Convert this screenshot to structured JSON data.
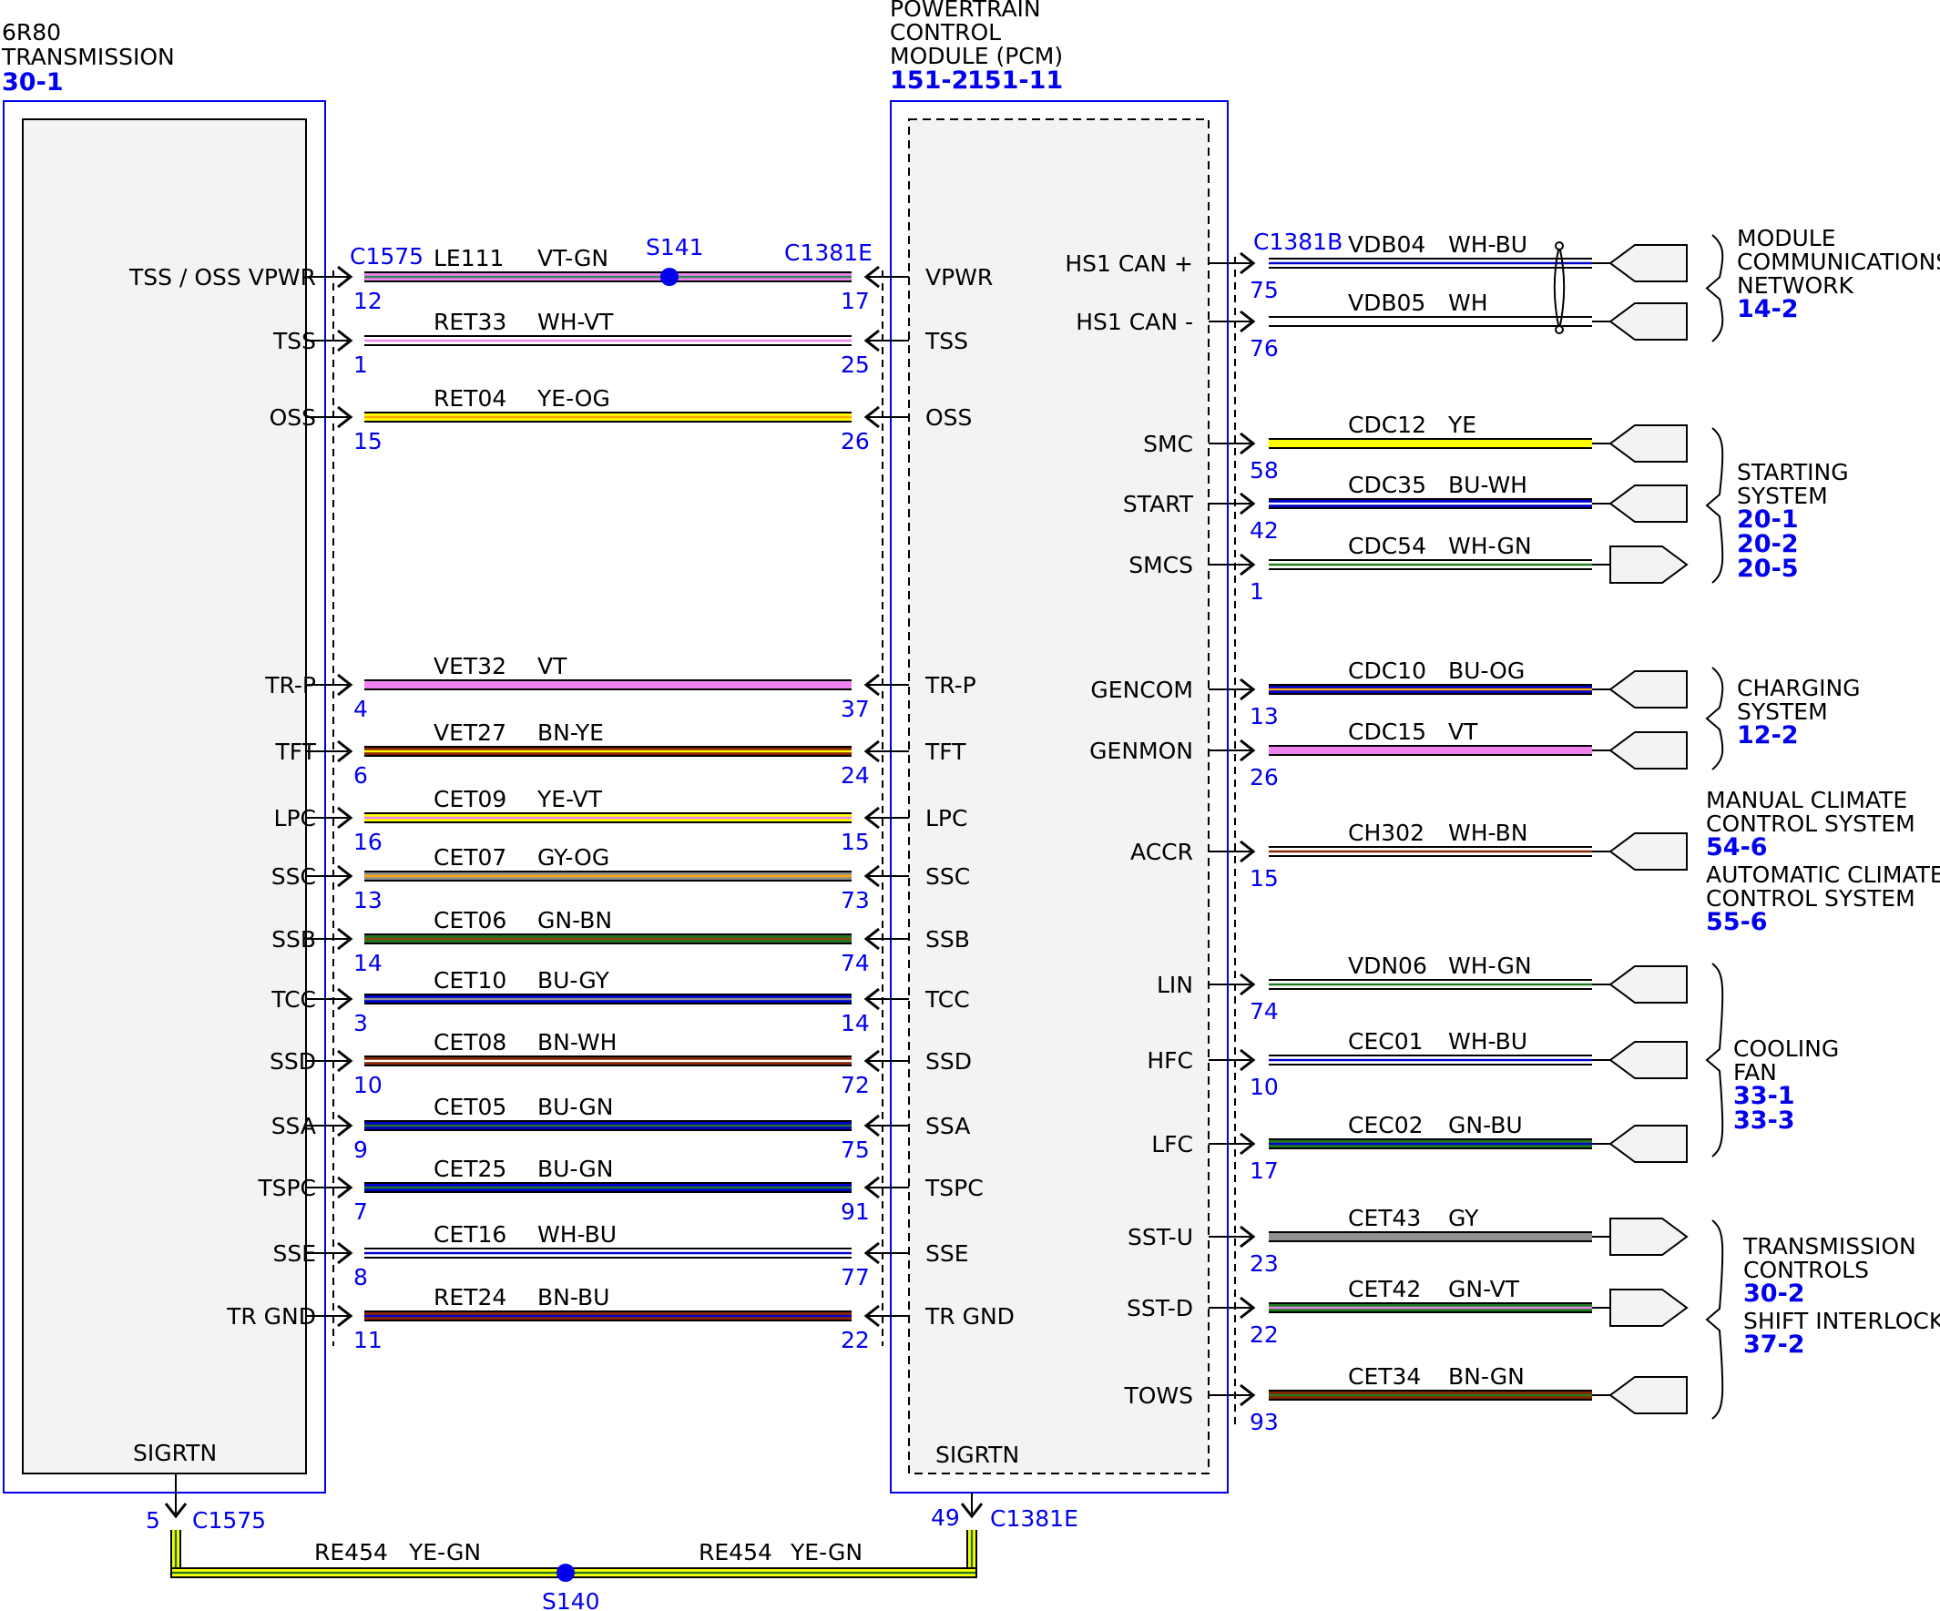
{
  "transmission": {
    "title": [
      "6R80",
      "TRANSMISSION"
    ],
    "ref": "30-1",
    "bottom_pin_label": "SIGRTN",
    "pins": [
      "TSS / OSS VPWR",
      "TSS",
      "OSS",
      "TR-P",
      "TFT",
      "LPC",
      "SSC",
      "SSB",
      "TCC",
      "SSD",
      "SSA",
      "TSPC",
      "SSE",
      "TR GND"
    ]
  },
  "pcm": {
    "title": [
      "POWERTRAIN",
      "CONTROL",
      "MODULE (PCM)"
    ],
    "refs": [
      "151-2",
      "151-11"
    ],
    "bottom_pin_label": "SIGRTN",
    "left_pins": [
      "VPWR",
      "TSS",
      "OSS",
      "TR-P",
      "TFT",
      "LPC",
      "SSC",
      "SSB",
      "TCC",
      "SSD",
      "SSA",
      "TSPC",
      "SSE",
      "TR GND"
    ],
    "right_pins": [
      "HS1 CAN +",
      "HS1 CAN -",
      "SMC",
      "START",
      "SMCS",
      "GENCOM",
      "GENMON",
      "ACCR",
      "LIN",
      "HFC",
      "LFC",
      "SST-U",
      "SST-D",
      "TOWS"
    ]
  },
  "connectors": {
    "left": "C1575",
    "pcm_left": "C1381E",
    "pcm_right": "C1381B",
    "bottom_left": "C1575",
    "bottom_right": "C1381E"
  },
  "splices": {
    "top": "S141",
    "bottom": "S140"
  },
  "left_circuits": [
    {
      "circuit": "LE111",
      "color": "VT-GN",
      "pin_a": "12",
      "pin_b": "17",
      "stripes": [
        "#ee82ee",
        "#2e8b57"
      ]
    },
    {
      "circuit": "RET33",
      "color": "WH-VT",
      "pin_a": "1",
      "pin_b": "25",
      "stripes": [
        "#ffffff",
        "#ee82ee"
      ]
    },
    {
      "circuit": "RET04",
      "color": "YE-OG",
      "pin_a": "15",
      "pin_b": "26",
      "stripes": [
        "#ffff00",
        "#ffa500"
      ]
    },
    {
      "circuit": "VET32",
      "color": "VT",
      "pin_a": "4",
      "pin_b": "37",
      "stripes": [
        "#ee82ee",
        "#ee82ee"
      ]
    },
    {
      "circuit": "VET27",
      "color": "BN-YE",
      "pin_a": "6",
      "pin_b": "24",
      "stripes": [
        "#8b2500",
        "#ffff00"
      ]
    },
    {
      "circuit": "CET09",
      "color": "YE-VT",
      "pin_a": "16",
      "pin_b": "15",
      "stripes": [
        "#ffff00",
        "#ee82ee"
      ]
    },
    {
      "circuit": "CET07",
      "color": "GY-OG",
      "pin_a": "13",
      "pin_b": "73",
      "stripes": [
        "#909090",
        "#ffa500"
      ]
    },
    {
      "circuit": "CET06",
      "color": "GN-BN",
      "pin_a": "14",
      "pin_b": "74",
      "stripes": [
        "#1f7a1f",
        "#8b4513"
      ]
    },
    {
      "circuit": "CET10",
      "color": "BU-GY",
      "pin_a": "3",
      "pin_b": "14",
      "stripes": [
        "#0000cc",
        "#909090"
      ]
    },
    {
      "circuit": "CET08",
      "color": "BN-WH",
      "pin_a": "10",
      "pin_b": "72",
      "stripes": [
        "#8b2500",
        "#ffffff"
      ]
    },
    {
      "circuit": "CET05",
      "color": "BU-GN",
      "pin_a": "9",
      "pin_b": "75",
      "stripes": [
        "#0000cc",
        "#1f7a1f"
      ]
    },
    {
      "circuit": "CET25",
      "color": "BU-GN",
      "pin_a": "7",
      "pin_b": "91",
      "stripes": [
        "#0000cc",
        "#1f7a1f"
      ]
    },
    {
      "circuit": "CET16",
      "color": "WH-BU",
      "pin_a": "8",
      "pin_b": "77",
      "stripes": [
        "#ffffff",
        "#0000cc"
      ]
    },
    {
      "circuit": "RET24",
      "color": "BN-BU",
      "pin_a": "11",
      "pin_b": "22",
      "stripes": [
        "#8b2500",
        "#0000cc"
      ]
    }
  ],
  "right_circuits": [
    {
      "circuit": "VDB04",
      "color": "WH-BU",
      "pin": "75",
      "stripes": [
        "#ffffff",
        "#0000cc"
      ]
    },
    {
      "circuit": "VDB05",
      "color": "WH",
      "pin": "76",
      "stripes": [
        "#ffffff",
        "#ffffff"
      ]
    },
    {
      "circuit": "CDC12",
      "color": "YE",
      "pin": "58",
      "stripes": [
        "#ffff00",
        "#ffff00"
      ]
    },
    {
      "circuit": "CDC35",
      "color": "BU-WH",
      "pin": "42",
      "stripes": [
        "#0000cc",
        "#ffffff"
      ]
    },
    {
      "circuit": "CDC54",
      "color": "WH-GN",
      "pin": "1",
      "stripes": [
        "#ffffff",
        "#1f7a1f"
      ]
    },
    {
      "circuit": "CDC10",
      "color": "BU-OG",
      "pin": "13",
      "stripes": [
        "#0000cc",
        "#ffa500"
      ]
    },
    {
      "circuit": "CDC15",
      "color": "VT",
      "pin": "26",
      "stripes": [
        "#ee82ee",
        "#ee82ee"
      ]
    },
    {
      "circuit": "CH302",
      "color": "WH-BN",
      "pin": "15",
      "stripes": [
        "#ffffff",
        "#8b2500"
      ]
    },
    {
      "circuit": "VDN06",
      "color": "WH-GN",
      "pin": "74",
      "stripes": [
        "#ffffff",
        "#1f7a1f"
      ]
    },
    {
      "circuit": "CEC01",
      "color": "WH-BU",
      "pin": "10",
      "stripes": [
        "#ffffff",
        "#0000cc"
      ]
    },
    {
      "circuit": "CEC02",
      "color": "GN-BU",
      "pin": "17",
      "stripes": [
        "#1f7a1f",
        "#0000cc"
      ]
    },
    {
      "circuit": "CET43",
      "color": "GY",
      "pin": "23",
      "stripes": [
        "#909090",
        "#909090"
      ]
    },
    {
      "circuit": "CET42",
      "color": "GN-VT",
      "pin": "22",
      "stripes": [
        "#1f7a1f",
        "#ee82ee"
      ]
    },
    {
      "circuit": "CET34",
      "color": "BN-GN",
      "pin": "93",
      "stripes": [
        "#8b2500",
        "#1f7a1f"
      ]
    }
  ],
  "sigrtn": {
    "pin_left": "5",
    "pin_right": "49",
    "circuit_left": "RE454",
    "color_left": "YE-GN",
    "circuit_right": "RE454",
    "color_right": "YE-GN",
    "stripes": [
      "#ffff00",
      "#1f7a1f"
    ]
  },
  "groups": [
    {
      "lines": [
        "MODULE",
        "COMMUNICATIONS",
        "NETWORK"
      ],
      "refs": [
        "14-2"
      ]
    },
    {
      "lines": [
        "STARTING",
        "SYSTEM"
      ],
      "refs": [
        "20-1",
        "20-2",
        "20-5"
      ]
    },
    {
      "lines": [
        "CHARGING",
        "SYSTEM"
      ],
      "refs": [
        "12-2"
      ]
    },
    {
      "lines": [
        "MANUAL CLIMATE",
        "CONTROL SYSTEM"
      ],
      "refs": [
        "54-6"
      ]
    },
    {
      "lines": [
        "AUTOMATIC CLIMATE",
        "CONTROL SYSTEM"
      ],
      "refs": [
        "55-6"
      ]
    },
    {
      "lines": [
        "COOLING",
        "FAN"
      ],
      "refs": [
        "33-1",
        "33-3"
      ]
    },
    {
      "lines": [
        "TRANSMISSION",
        "CONTROLS"
      ],
      "refs": [
        "30-2"
      ]
    },
    {
      "lines": [
        "SHIFT INTERLOCK"
      ],
      "refs": [
        "37-2"
      ]
    }
  ]
}
